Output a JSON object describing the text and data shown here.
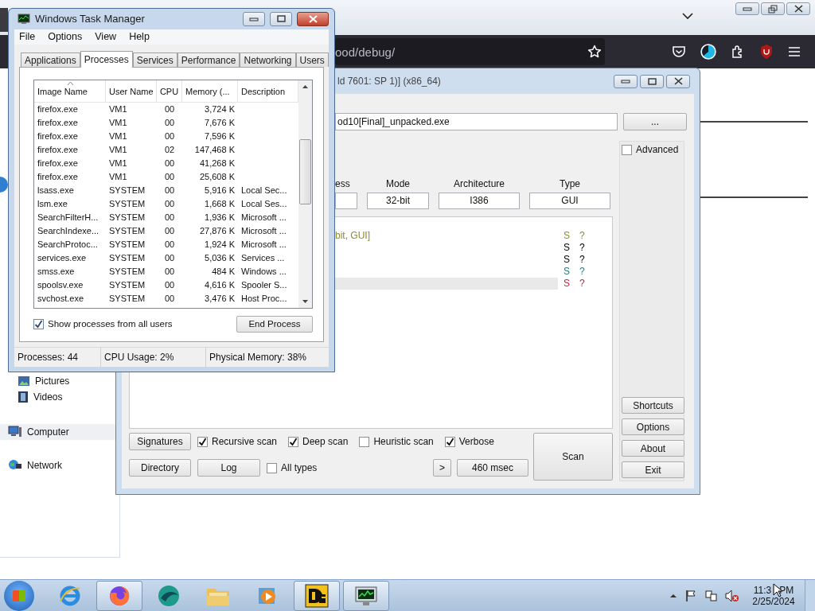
{
  "browser": {
    "url": "ood/debug/"
  },
  "explorer": {
    "nav": [
      {
        "label": "Pictures",
        "kind": "pictures",
        "selected": false
      },
      {
        "label": "Videos",
        "kind": "videos",
        "selected": false
      },
      {
        "label": "Computer",
        "kind": "computer",
        "selected": true
      },
      {
        "label": "Network",
        "kind": "network",
        "selected": false
      }
    ]
  },
  "detector": {
    "title": "ld 7601: SP 1)] (x86_64)",
    "file_path": "od10[Final]_unpacked.exe",
    "browse": "...",
    "advanced": {
      "label": "Advanced",
      "checked": false
    },
    "fields": [
      {
        "label": "ess"
      },
      {
        "label": "Mode",
        "value": "32-bit"
      },
      {
        "label": "Architecture",
        "value": "I386"
      },
      {
        "label": "Type",
        "value": "GUI"
      }
    ],
    "results": [
      {
        "text": "bit, GUI]",
        "s": "S",
        "q": "?",
        "color": "#8c8c28",
        "selected": false
      },
      {
        "s": "S",
        "q": "?",
        "color": "#000000",
        "selected": false
      },
      {
        "s": "S",
        "q": "?",
        "color": "#000000",
        "selected": false
      },
      {
        "s": "S",
        "q": "?",
        "color": "#2a7a80",
        "selected": false
      },
      {
        "s": "S",
        "q": "?",
        "color": "#c8203c",
        "selected": true
      }
    ],
    "side_buttons": [
      "Shortcuts",
      "Options",
      "About",
      "Exit"
    ],
    "signatures": "Signatures",
    "options": [
      {
        "label": "Recursive scan",
        "checked": true
      },
      {
        "label": "Deep scan",
        "checked": true
      },
      {
        "label": "Heuristic scan",
        "checked": false
      },
      {
        "label": "Verbose",
        "checked": true
      }
    ],
    "directory": "Directory",
    "log": "Log",
    "all_types": {
      "label": "All types",
      "checked": false
    },
    "more": ">",
    "elapsed": "460 msec",
    "scan": "Scan"
  },
  "task_manager": {
    "title": "Windows Task Manager",
    "menu": [
      "File",
      "Options",
      "View",
      "Help"
    ],
    "tabs": [
      {
        "label": "Applications",
        "selected": false
      },
      {
        "label": "Processes",
        "selected": true
      },
      {
        "label": "Services",
        "selected": false
      },
      {
        "label": "Performance",
        "selected": false
      },
      {
        "label": "Networking",
        "selected": false
      },
      {
        "label": "Users",
        "selected": false
      }
    ],
    "columns": [
      "Image Name",
      "User Name",
      "CPU",
      "Memory (...",
      "Description"
    ],
    "rows": [
      {
        "image": "firefox.exe",
        "user": "VM1",
        "cpu": "00",
        "memory": "3,724 K"
      },
      {
        "image": "firefox.exe",
        "user": "VM1",
        "cpu": "00",
        "memory": "7,676 K"
      },
      {
        "image": "firefox.exe",
        "user": "VM1",
        "cpu": "00",
        "memory": "7,596 K"
      },
      {
        "image": "firefox.exe",
        "user": "VM1",
        "cpu": "02",
        "memory": "147,468 K"
      },
      {
        "image": "firefox.exe",
        "user": "VM1",
        "cpu": "00",
        "memory": "41,268 K"
      },
      {
        "image": "firefox.exe",
        "user": "VM1",
        "cpu": "00",
        "memory": "25,608 K"
      },
      {
        "image": "lsass.exe",
        "user": "SYSTEM",
        "cpu": "00",
        "memory": "5,916 K",
        "description": "Local Sec..."
      },
      {
        "image": "lsm.exe",
        "user": "SYSTEM",
        "cpu": "00",
        "memory": "1,668 K",
        "description": "Local Ses..."
      },
      {
        "image": "SearchFilterH...",
        "user": "SYSTEM",
        "cpu": "00",
        "memory": "1,936 K",
        "description": "Microsoft ..."
      },
      {
        "image": "SearchIndexe...",
        "user": "SYSTEM",
        "cpu": "00",
        "memory": "27,876 K",
        "description": "Microsoft ..."
      },
      {
        "image": "SearchProtoc...",
        "user": "SYSTEM",
        "cpu": "00",
        "memory": "1,924 K",
        "description": "Microsoft ..."
      },
      {
        "image": "services.exe",
        "user": "SYSTEM",
        "cpu": "00",
        "memory": "5,036 K",
        "description": "Services ..."
      },
      {
        "image": "smss.exe",
        "user": "SYSTEM",
        "cpu": "00",
        "memory": "484 K",
        "description": "Windows ..."
      },
      {
        "image": "spoolsv.exe",
        "user": "SYSTEM",
        "cpu": "00",
        "memory": "4,616 K",
        "description": "Spooler S..."
      },
      {
        "image": "svchost.exe",
        "user": "SYSTEM",
        "cpu": "00",
        "memory": "3,476 K",
        "description": "Host Proc..."
      }
    ],
    "show_all": {
      "label": "Show processes from all users",
      "checked": true
    },
    "end_process": "End Process",
    "status": [
      "Processes: 44",
      "CPU Usage: 2%",
      "Physical Memory: 38%"
    ]
  },
  "taskbar": {
    "items": [
      {
        "kind": "browser-e",
        "selected": false
      },
      {
        "kind": "firefox",
        "selected": true
      },
      {
        "kind": "bird",
        "selected": false
      },
      {
        "kind": "folder",
        "selected": false
      },
      {
        "kind": "media",
        "selected": false
      },
      {
        "kind": "detector",
        "selected": true
      },
      {
        "kind": "monitor",
        "selected": true
      }
    ],
    "time": "11:3",
    "meridiem": "PM",
    "date": "2/25/2024"
  }
}
